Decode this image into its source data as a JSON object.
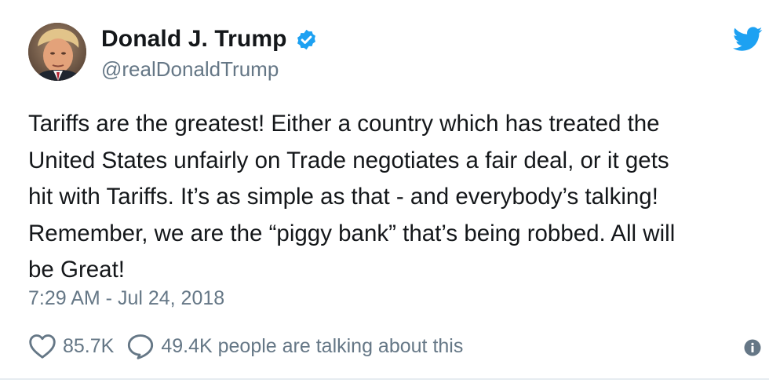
{
  "account": {
    "display_name": "Donald J. Trump",
    "handle": "@realDonaldTrump",
    "verified_icon": "verified-badge-icon",
    "avatar": "profile-photo"
  },
  "tweet": {
    "text": "Tariffs are the greatest! Either a country which has treated the\nUnited States unfairly on Trade negotiates a fair deal, or it gets\nhit with Tariffs. It’s as simple as that - and everybody’s talking!\nRemember, we are the “piggy bank” that’s being robbed. All will\nbe Great!",
    "timestamp": "7:29 AM - Jul 24, 2018"
  },
  "actions": {
    "like_count": "85.7K",
    "talking_text": "49.4K people are talking about this"
  },
  "icons": {
    "brand": "twitter-bird-icon",
    "like": "heart-icon",
    "reply": "speech-bubble-icon",
    "info": "info-icon"
  },
  "colors": {
    "brand_blue": "#1da1f2",
    "text_primary": "#14171a",
    "text_secondary": "#657786"
  }
}
